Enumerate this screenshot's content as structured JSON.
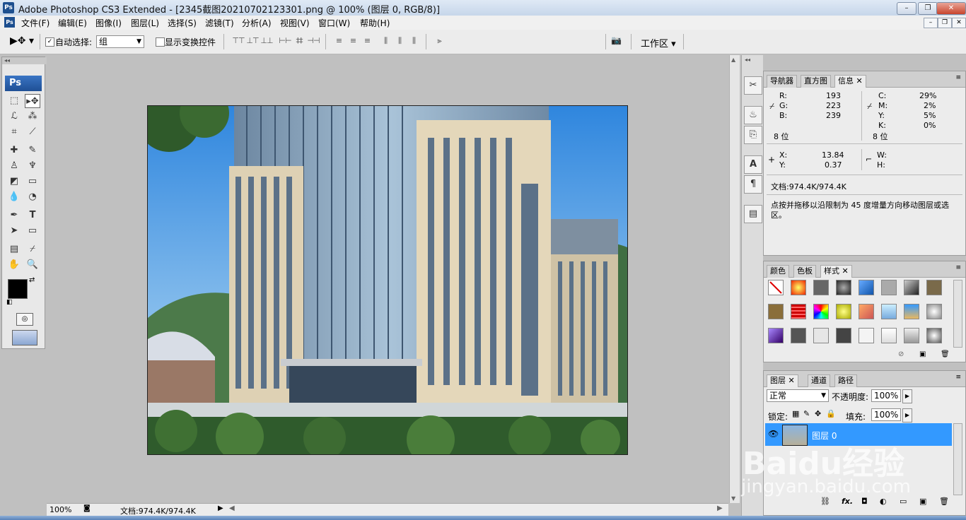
{
  "window": {
    "title": "Adobe Photoshop CS3 Extended - [2345截图20210702123301.png @ 100% (图层 0, RGB/8)]",
    "logo": "Ps"
  },
  "menu": [
    "文件(F)",
    "编辑(E)",
    "图像(I)",
    "图层(L)",
    "选择(S)",
    "滤镜(T)",
    "分析(A)",
    "视图(V)",
    "窗口(W)",
    "帮助(H)"
  ],
  "options": {
    "auto_select_label": "自动选择:",
    "auto_select_checked": true,
    "group_value": "组",
    "show_transform_label": "显示变换控件",
    "show_transform_checked": false,
    "workspace_label": "工作区"
  },
  "toolbox": {
    "logo": "Ps"
  },
  "status": {
    "zoom": "100%",
    "doc": "文档:974.4K/974.4K"
  },
  "info_panel": {
    "tabs": [
      "导航器",
      "直方图",
      "信息"
    ],
    "active_tab": "信息",
    "rgb": {
      "r_label": "R:",
      "r": "193",
      "g_label": "G:",
      "g": "223",
      "b_label": "B:",
      "b": "239",
      "bits": "8 位"
    },
    "cmyk": {
      "c_label": "C:",
      "c": "29%",
      "m_label": "M:",
      "m": "2%",
      "y_label": "Y:",
      "y": "5%",
      "k_label": "K:",
      "k": "0%",
      "bits": "8 位"
    },
    "xy": {
      "x_label": "X:",
      "x": "13.84",
      "y_label": "Y:",
      "y": "0.37"
    },
    "wh": {
      "w_label": "W:",
      "h_label": "H:"
    },
    "doc": "文档:974.4K/974.4K",
    "hint": "点按并拖移以沿限制为 45 度增量方向移动图层或选区。"
  },
  "styles_panel": {
    "tabs": [
      "颜色",
      "色板",
      "样式"
    ],
    "active_tab": "样式"
  },
  "layers_panel": {
    "tabs": [
      "图层",
      "通道",
      "路径"
    ],
    "active_tab": "图层",
    "blend_mode": "正常",
    "opacity_label": "不透明度:",
    "opacity": "100%",
    "lock_label": "锁定:",
    "fill_label": "填充:",
    "fill": "100%",
    "layer_name": "图层 0"
  },
  "watermark": {
    "text": "Baidu经验",
    "url": "jingyan.baidu.com"
  },
  "colors": {
    "accent": "#3399ff",
    "fg": "#000000",
    "bg": "#ffffff"
  }
}
